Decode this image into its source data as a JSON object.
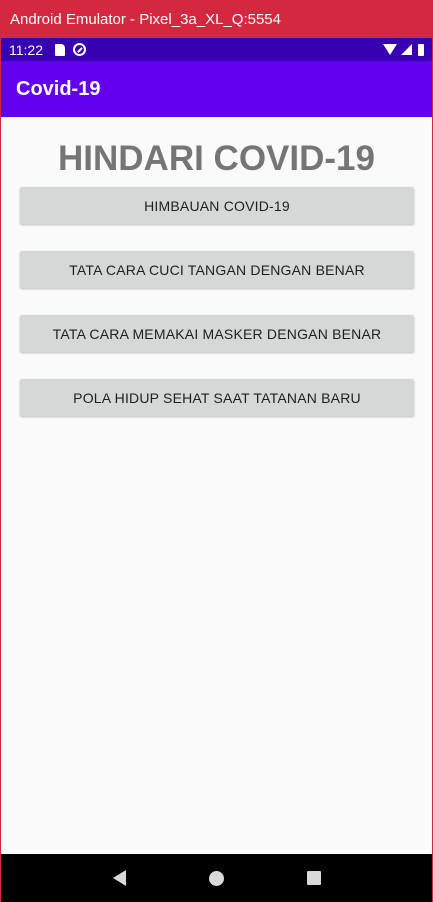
{
  "window": {
    "title": "Android Emulator - Pixel_3a_XL_Q:5554"
  },
  "status_bar": {
    "time": "11:22",
    "icons_left": [
      "sd-card-icon",
      "sync-icon"
    ],
    "icons_right": [
      "wifi-icon",
      "signal-icon",
      "battery-icon"
    ]
  },
  "app_bar": {
    "title": "Covid-19"
  },
  "main": {
    "headline": "HINDARI COVID-19",
    "buttons": [
      {
        "label": "HIMBAUAN COVID-19"
      },
      {
        "label": "TATA CARA CUCI TANGAN DENGAN BENAR"
      },
      {
        "label": "TATA CARA MEMAKAI MASKER DENGAN BENAR"
      },
      {
        "label": "POLA HIDUP SEHAT SAAT TATANAN BARU"
      }
    ]
  },
  "nav_bar": {
    "icons": [
      "back-icon",
      "home-icon",
      "recents-icon"
    ]
  },
  "colors": {
    "window_titlebar": "#d3283f",
    "status_bar": "#3700b3",
    "app_bar": "#6200ee",
    "headline": "#757575",
    "button_bg": "#d6d7d7"
  }
}
